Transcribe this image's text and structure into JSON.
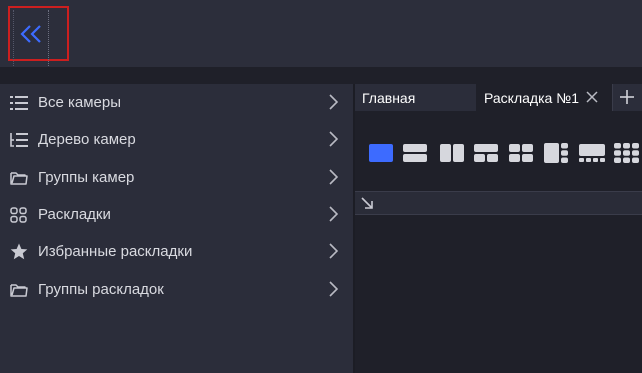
{
  "header": {
    "collapse_icon": "double-chevron-left-icon",
    "accent": "#3d6bff",
    "highlight": "#cc1f1f"
  },
  "sidebar": {
    "items": [
      {
        "label": "Все камеры",
        "icon": "list-icon"
      },
      {
        "label": "Дерево камер",
        "icon": "tree-icon"
      },
      {
        "label": "Группы камер",
        "icon": "folder-icon"
      },
      {
        "label": "Раскладки",
        "icon": "grid-icon"
      },
      {
        "label": "Избранные раскладки",
        "icon": "star-icon"
      },
      {
        "label": "Группы раскладок",
        "icon": "folder-icon"
      }
    ]
  },
  "tabs": {
    "main_label": "Главная",
    "layout_label": "Раскладка №1",
    "close_icon": "close-icon",
    "add_icon": "plus-icon"
  },
  "layout_toolbar": {
    "buttons": [
      "layout-1x1-icon",
      "layout-2-rows-icon",
      "layout-2-cols-icon",
      "layout-3-cells-icon",
      "layout-2x2-icon",
      "layout-1plus3-icon",
      "layout-1plus5-icon",
      "layout-3x3-icon"
    ],
    "selected_index": 0
  }
}
